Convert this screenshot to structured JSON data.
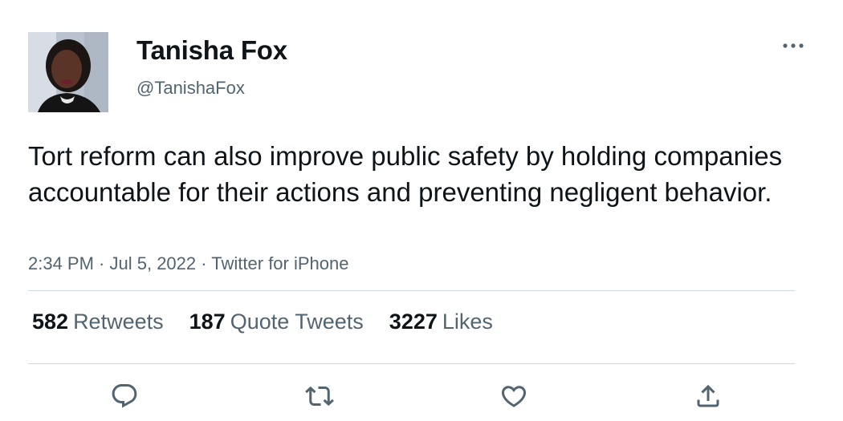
{
  "user": {
    "display_name": "Tanisha Fox",
    "handle": "@TanishaFox",
    "avatar_icon": "profile-photo"
  },
  "tweet": {
    "text": "Tort reform can also improve public safety by holding companies accountable for their actions and preventing negligent behavior.",
    "time": "2:34 PM",
    "separator": " · ",
    "date": "Jul 5, 2022",
    "source": "Twitter for iPhone"
  },
  "stats": {
    "retweets": {
      "count": "582",
      "label": "Retweets"
    },
    "quote_tweets": {
      "count": "187",
      "label": "Quote Tweets"
    },
    "likes": {
      "count": "3227",
      "label": "Likes"
    }
  },
  "actions": [
    {
      "name": "reply",
      "icon": "reply-icon"
    },
    {
      "name": "retweet",
      "icon": "retweet-icon"
    },
    {
      "name": "like",
      "icon": "heart-icon"
    },
    {
      "name": "share",
      "icon": "share-icon"
    }
  ],
  "colors": {
    "text_primary": "#0f1419",
    "text_secondary": "#536471",
    "divider": "#cfd9de"
  }
}
